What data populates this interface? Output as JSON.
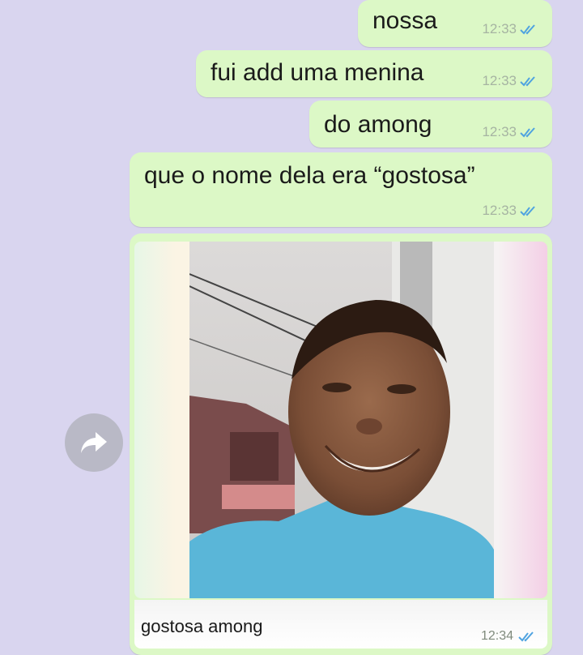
{
  "messages": [
    {
      "text": "nossa",
      "time": "12:33"
    },
    {
      "text": "fui add uma menina",
      "time": "12:33"
    },
    {
      "text": "do among",
      "time": "12:33"
    },
    {
      "text": "que o nome dela era “gostosa”",
      "time": "12:33"
    }
  ],
  "image_message": {
    "caption": "gostosa among",
    "time": "12:34",
    "image_alt": "selfie photo"
  },
  "icons": {
    "read_receipt": "double-check-icon",
    "forward": "forward-icon"
  },
  "colors": {
    "chat_background": "#d9d5ef",
    "outgoing_bubble": "#dcf8c6",
    "read_ticks": "#4fa3e0"
  }
}
